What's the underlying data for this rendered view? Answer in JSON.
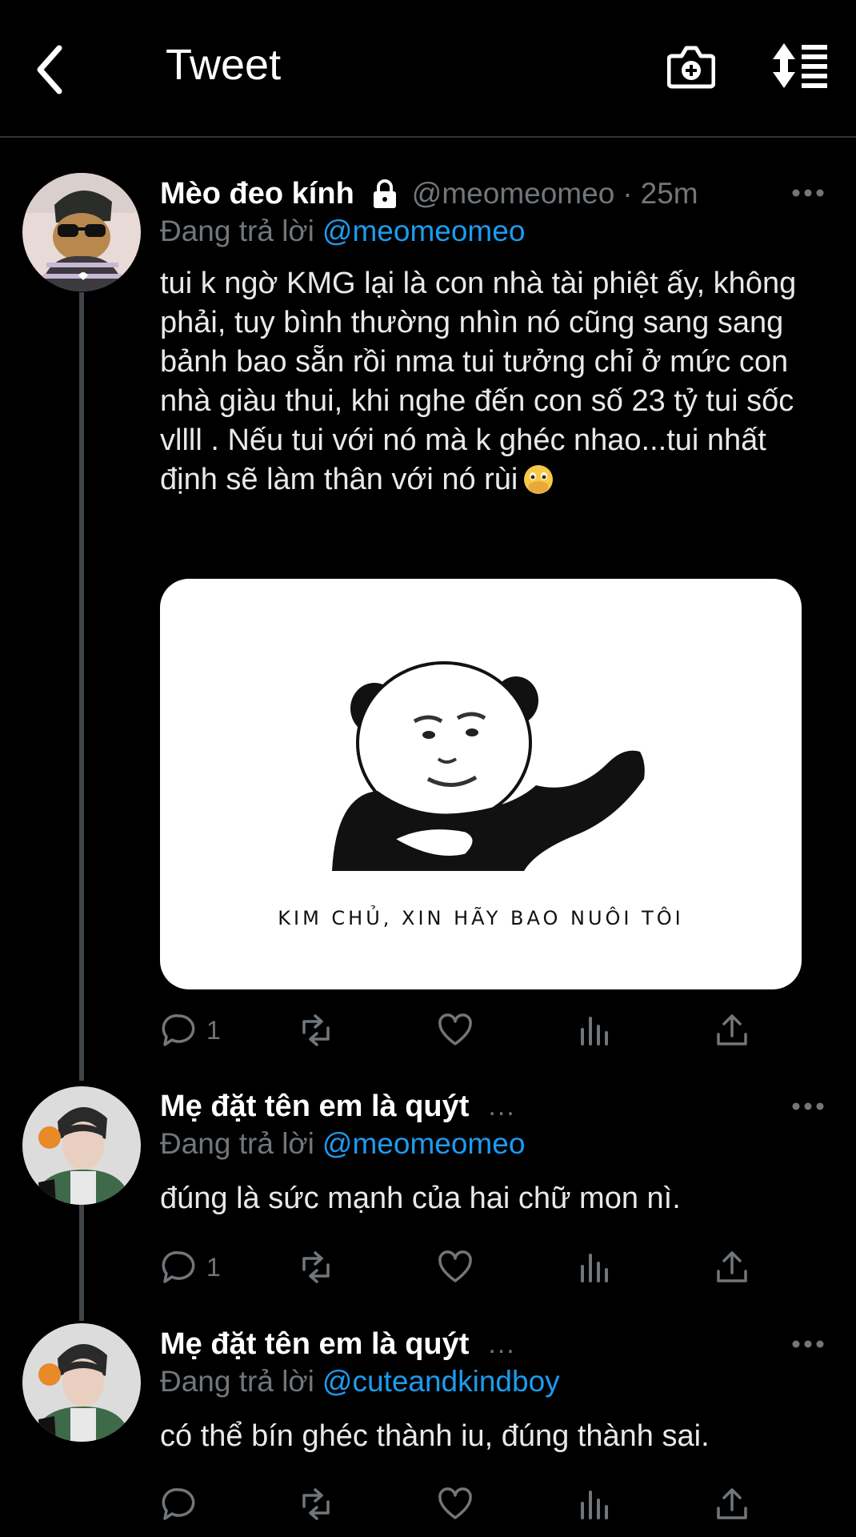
{
  "header": {
    "title": "Tweet",
    "icons": [
      "back-arrow-icon",
      "camera-add-icon",
      "sort-icon"
    ]
  },
  "tweets": [
    {
      "display_name": "Mèo đeo kính",
      "handle": "@meomeomeo",
      "separator": "·",
      "time": "25m",
      "reply_prefix": "Đang trả lời",
      "reply_to": "@meomeomeo",
      "text": "tui k ngờ KMG lại là con nhà tài phiệt ấy, không phải, tuy bình thường nhìn nó cũng sang sang bảnh bao sẵn rồi nma tui tưởng chỉ ở mức con nhà giàu thui, khi nghe đến con số 23 tỷ tui sốc vllll . Nếu tui với nó mà k ghéc nhao...tui nhất định sẽ làm thân với nó rùi",
      "emoji": "face-with-open-eyes-and-hand-over-mouth",
      "media_caption": "KIM CHỦ, XIN HÃY BAO NUÔI TÔI",
      "reply_count": "1"
    },
    {
      "display_name": "Mẹ đặt tên em là quýt",
      "truncation": "...",
      "reply_prefix": "Đang trả lời",
      "reply_to": "@meomeomeo",
      "text": "đúng là sức mạnh của hai chữ mon nì.",
      "reply_count": "1"
    },
    {
      "display_name": "Mẹ đặt tên em là quýt",
      "truncation": "...",
      "reply_prefix": "Đang trả lời",
      "reply_to": "@cuteandkindboy",
      "text": "có thể bín ghéc thành iu, đúng thành sai.",
      "reply_count": ""
    }
  ],
  "colors": {
    "background": "#000000",
    "text": "#e7e9ea",
    "secondary": "#71767b",
    "mention": "#1d9bf0",
    "thread_line": "#3f4448"
  }
}
